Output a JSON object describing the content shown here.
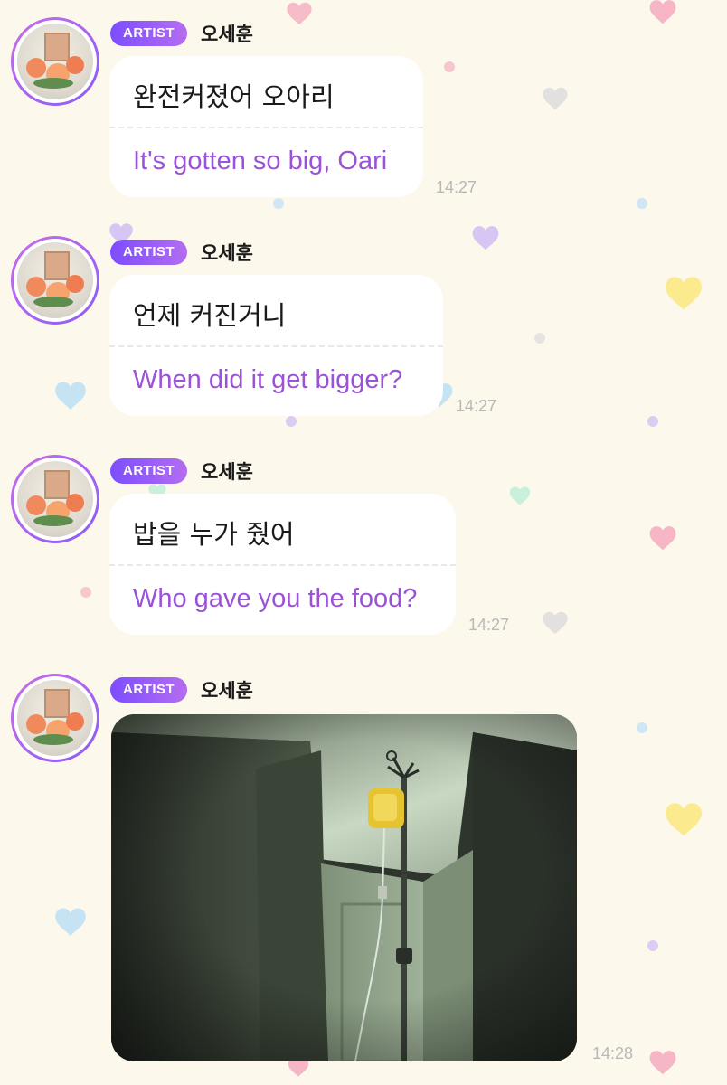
{
  "colors": {
    "background": "#fdf8ec",
    "badge_start": "#7c4dff",
    "badge_end": "#b46df0",
    "translation_text": "#9a52d8",
    "time_text": "#b8b8b8"
  },
  "messages": [
    {
      "badge": "ARTIST",
      "sender": "오세훈",
      "korean": "완전커졌어 오아리",
      "english": "It's gotten so big, Oari",
      "time": "14:27"
    },
    {
      "badge": "ARTIST",
      "sender": "오세훈",
      "korean": "언제 커진거니",
      "english": "When did it get bigger?",
      "time": "14:27"
    },
    {
      "badge": "ARTIST",
      "sender": "오세훈",
      "korean": "밥을 누가 줬어",
      "english": "Who gave you the food?",
      "time": "14:27"
    },
    {
      "badge": "ARTIST",
      "sender": "오세훈",
      "image": "iv-drip-stand-photo",
      "time": "14:28"
    }
  ]
}
